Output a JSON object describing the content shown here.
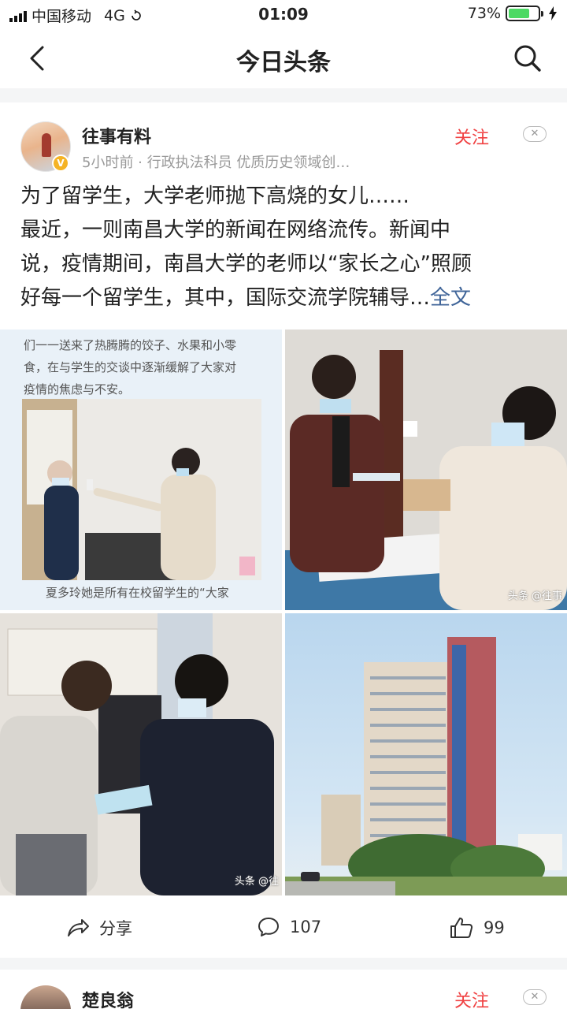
{
  "status_bar": {
    "carrier": "中国移动",
    "network": "4G",
    "time": "01:09",
    "battery_percent": "73%",
    "battery_level": 0.73
  },
  "nav": {
    "back_icon": "chevron-left-icon",
    "title": "今日头条",
    "search_icon": "search-icon"
  },
  "post": {
    "author": "往事有料",
    "verified_badge": "V",
    "meta": "5小时前 · 行政执法科员 优质历史领域创…",
    "follow_label": "关注",
    "dismiss_label": "✕",
    "lines": [
      "为了留学生，大学老师抛下高烧的女儿……",
      "最近，一则南昌大学的新闻在网络流传。新闻中",
      "说，疫情期间，南昌大学的老师以“家长之心”照顾",
      "好每一个留学生，其中，国际交流学院辅导…"
    ],
    "fulltext_label": "全文",
    "images": {
      "img1_text_top": "们一一送来了热腾腾的饺子、水果和小零",
      "img1_text_mid": "食，在与学生的交谈中逐渐缓解了大家对",
      "img1_text_bot": "疫情的焦虑与不安。",
      "img1_caption": "夏多玲她是所有在校留学生的“大家",
      "img2_watermark": "头条 @往事",
      "img3_watermark": "头条 @往"
    },
    "actions": {
      "share_icon": "share-arrow-icon",
      "share_label": "分享",
      "comment_icon": "comment-bubble-icon",
      "comment_count": "107",
      "like_icon": "thumbs-up-icon",
      "like_count": "99"
    }
  },
  "next_post": {
    "author": "楚良翁",
    "follow_label": "关注",
    "dismiss_label": "✕"
  },
  "colors": {
    "accent_red": "#f04142",
    "link_blue": "#406599",
    "meta_gray": "#999999"
  }
}
